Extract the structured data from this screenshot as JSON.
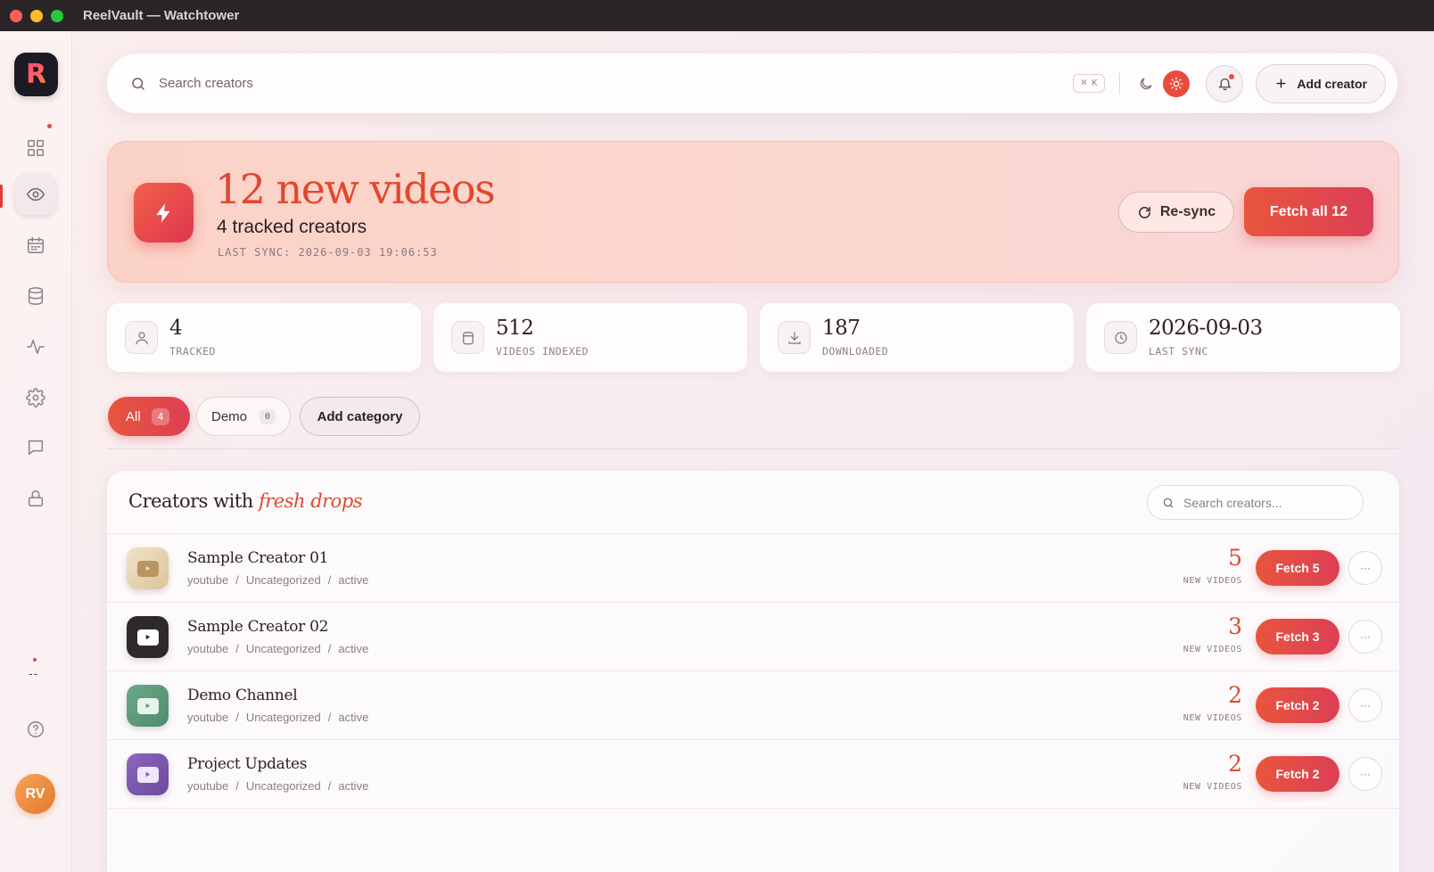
{
  "window": {
    "title": "ReelVault — Watchtower"
  },
  "sidebar": {
    "logo_letter": "R",
    "items": [
      {
        "name": "dashboard",
        "icon": "grid-icon"
      },
      {
        "name": "watchtower",
        "icon": "eye-icon"
      },
      {
        "name": "calendar",
        "icon": "calendar-icon"
      },
      {
        "name": "library",
        "icon": "database-icon"
      },
      {
        "name": "activity",
        "icon": "pulse-icon"
      },
      {
        "name": "settings",
        "icon": "gear-icon"
      },
      {
        "name": "messages",
        "icon": "chat-icon"
      },
      {
        "name": "vault",
        "icon": "lock-icon"
      }
    ],
    "separator": "--",
    "avatar_initials": "RV"
  },
  "topbar": {
    "search_placeholder": "Search creators",
    "shortcut": "⌘ K",
    "add_creator_label": "Add creator"
  },
  "hero": {
    "title": "12 new videos",
    "subtitle": "4 tracked creators",
    "last_sync": "LAST SYNC: 2026-09-03 19:06:53",
    "resync_label": "Re-sync",
    "fetch_all_label": "Fetch all 12"
  },
  "stats": [
    {
      "value": "4",
      "label": "TRACKED",
      "icon": "user-icon"
    },
    {
      "value": "512",
      "label": "VIDEOS INDEXED",
      "icon": "database-icon"
    },
    {
      "value": "187",
      "label": "DOWNLOADED",
      "icon": "download-icon"
    },
    {
      "value": "2026-09-03",
      "label": "LAST SYNC",
      "icon": "clock-icon"
    }
  ],
  "categories": [
    {
      "label": "All",
      "count": "4",
      "active": true
    },
    {
      "label": "Demo",
      "count": "0",
      "active": false
    }
  ],
  "add_category_label": "Add category",
  "creators_panel": {
    "title_prefix": "Creators with",
    "title_accent": "fresh drops",
    "search_placeholder": "Search creators...",
    "rows": [
      {
        "name": "Sample Creator 01",
        "platform": "youtube",
        "category": "Uncategorized",
        "status": "active",
        "new_count": "5",
        "new_label": "NEW VIDEOS",
        "fetch_label": "Fetch 5",
        "color": "#e6d3b8",
        "play_color": "#b9945e"
      },
      {
        "name": "Sample Creator 02",
        "platform": "youtube",
        "category": "Uncategorized",
        "status": "active",
        "new_count": "3",
        "new_label": "NEW VIDEOS",
        "fetch_label": "Fetch 3",
        "color": "#2e2a2c",
        "play_color": "#ffffff"
      },
      {
        "name": "Demo Channel",
        "platform": "youtube",
        "category": "Uncategorized",
        "status": "active",
        "new_count": "2",
        "new_label": "NEW VIDEOS",
        "fetch_label": "Fetch 2",
        "color": "#5d9b7a",
        "play_color": "#e8f3ec"
      },
      {
        "name": "Project Updates",
        "platform": "youtube",
        "category": "Uncategorized",
        "status": "active",
        "new_count": "2",
        "new_label": "NEW VIDEOS",
        "fetch_label": "Fetch 2",
        "color": "#7e5bb0",
        "play_color": "#efe7fa"
      }
    ],
    "more_label": "···"
  },
  "colors": {
    "accent": "#e0482f",
    "accent_gradient_end": "#dc3f55"
  }
}
